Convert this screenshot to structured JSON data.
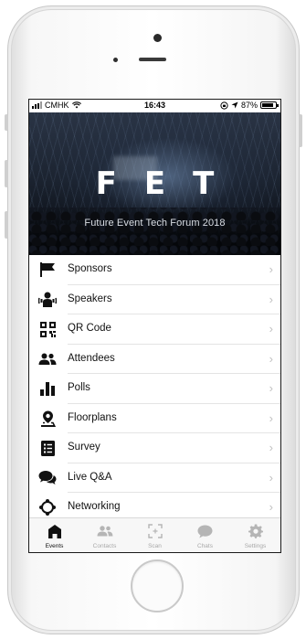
{
  "status_bar": {
    "carrier": "CMHK",
    "time": "16:43",
    "battery": "87%",
    "battery_level": 0.87
  },
  "hero": {
    "logo": "FET",
    "subtitle": "Future Event Tech Forum 2018"
  },
  "menu": {
    "items": [
      {
        "label": "Sponsors",
        "icon": "flag-icon"
      },
      {
        "label": "Speakers",
        "icon": "speakers-icon"
      },
      {
        "label": "QR Code",
        "icon": "qr-code-icon"
      },
      {
        "label": "Attendees",
        "icon": "attendees-icon"
      },
      {
        "label": "Polls",
        "icon": "bar-chart-icon"
      },
      {
        "label": "Floorplans",
        "icon": "map-pin-icon"
      },
      {
        "label": "Survey",
        "icon": "survey-icon"
      },
      {
        "label": "Live Q&A",
        "icon": "chat-bubbles-icon"
      },
      {
        "label": "Networking",
        "icon": "networking-icon"
      }
    ],
    "chevron": "›"
  },
  "tabbar": {
    "tabs": [
      {
        "label": "Events",
        "icon": "home-icon",
        "active": true
      },
      {
        "label": "Contacts",
        "icon": "contacts-icon",
        "active": false
      },
      {
        "label": "Scan",
        "icon": "scan-icon",
        "active": false
      },
      {
        "label": "Chats",
        "icon": "chat-icon",
        "active": false
      },
      {
        "label": "Settings",
        "icon": "gear-icon",
        "active": false
      }
    ]
  },
  "colors": {
    "icon_dark": "#111111",
    "tab_inactive": "#a8a8a8",
    "separator": "#e4e4e4"
  }
}
